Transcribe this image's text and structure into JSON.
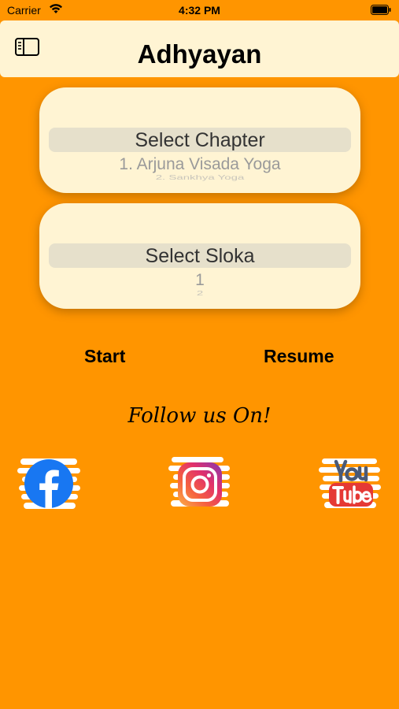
{
  "status_bar": {
    "carrier": "Carrier",
    "time": "4:32 PM"
  },
  "nav": {
    "title": "Adhyayan",
    "sidebar_icon": "sidebar-icon"
  },
  "chapter_picker": {
    "selected": "Select Chapter",
    "next": "1. Arjuna Visada Yoga",
    "next2": "2. Sankhya Yoga"
  },
  "sloka_picker": {
    "selected": "Select Sloka",
    "next": "1",
    "next2": "2"
  },
  "actions": {
    "start": "Start",
    "resume": "Resume"
  },
  "follow": {
    "label": "Follow us On!",
    "links": [
      "facebook-icon",
      "instagram-icon",
      "youtube-icon"
    ]
  },
  "colors": {
    "background": "#FF9500",
    "card": "#FFF4D3",
    "facebook": "#1877F2",
    "youtube_red": "#E53935"
  }
}
